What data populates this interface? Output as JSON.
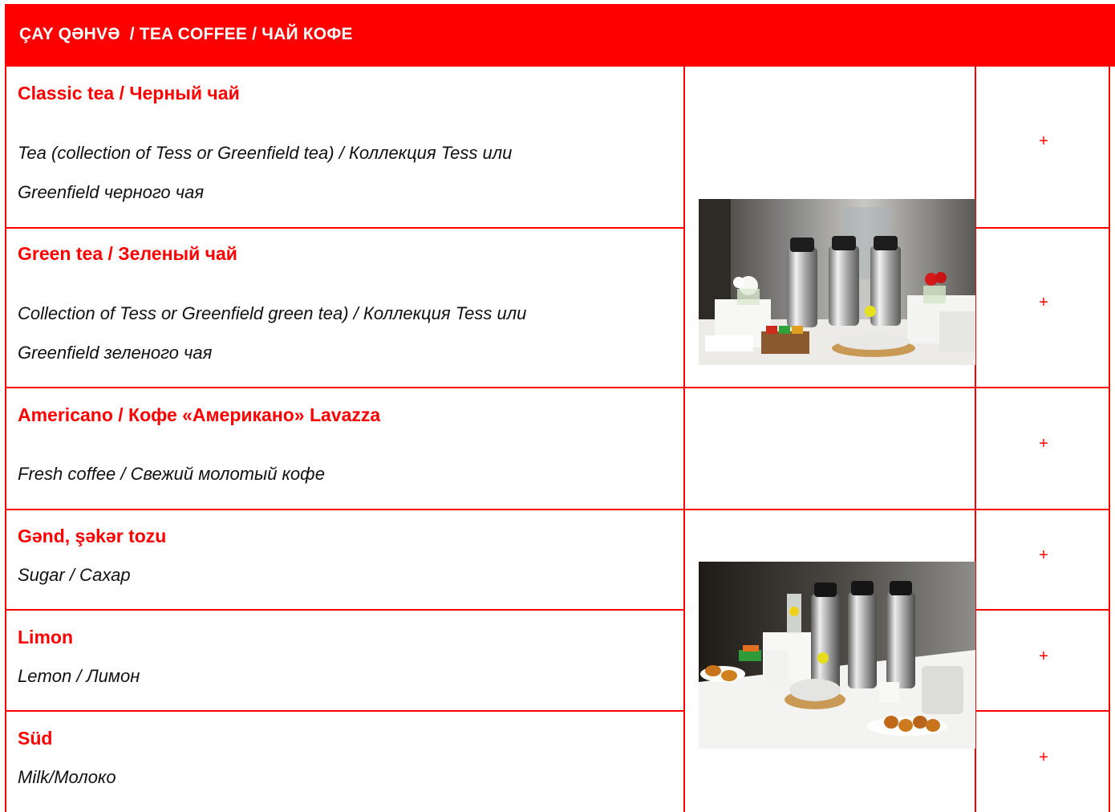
{
  "header": {
    "title": "ÇAY QƏHVƏ  / TEA COFFEE / ЧАЙ КОФЕ"
  },
  "items": [
    {
      "name": "Classic tea / Черный чай",
      "desc": [
        "Tea (collection of Tess or Greenfield tea) / Коллекция Tess или",
        "Greenfield черного чая"
      ],
      "action": "+"
    },
    {
      "name": "Green tea / Зеленый чай",
      "desc": [
        "Collection of Tess or Greenfield green tea) / Коллекция Tess  или",
        "Greenfield зеленого чая"
      ],
      "action": "+"
    },
    {
      "name": "Americano / Кофе «Американо» Lavazza",
      "desc": [
        "Fresh coffee / Свежий молотый кофе"
      ],
      "action": "+"
    },
    {
      "name": "Gənd, şəkər tozu",
      "desc": [
        "Sugar / Сахар"
      ],
      "action": "+"
    },
    {
      "name": "Limon",
      "desc": [
        "Lemon / Лимон"
      ],
      "action": "+"
    },
    {
      "name": "Süd",
      "desc": [
        "Milk/Молоко"
      ],
      "action": "+"
    }
  ],
  "colors": {
    "accent": "#ff0000",
    "text": "#111111"
  }
}
